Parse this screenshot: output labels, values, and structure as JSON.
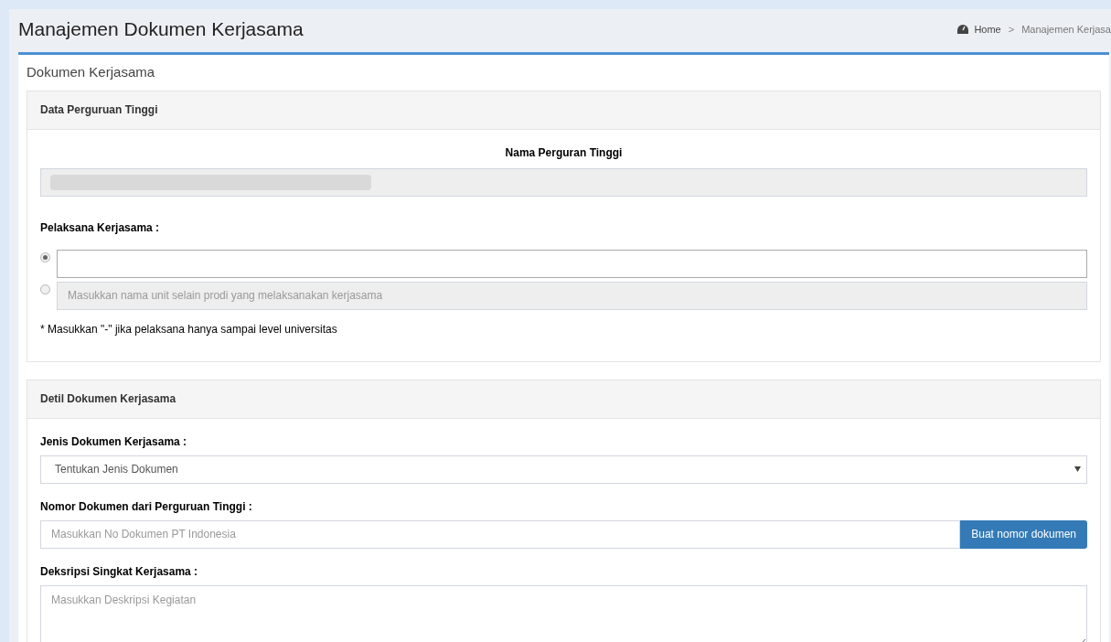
{
  "header": {
    "title": "Manajemen Dokumen Kerjasama",
    "breadcrumb": [
      {
        "label": "Home"
      },
      {
        "label": "Manajemen Kerjasa"
      }
    ],
    "breadcrumb_separator": ">"
  },
  "box_title": "Dokumen Kerjasama",
  "panels": [
    {
      "heading": "Data Perguruan Tinggi",
      "fields": [
        {
          "kind": "readonly",
          "label": "Nama Perguran Tinggi"
        },
        {
          "kind": "radio_group",
          "label": "Pelaksana Kerjasama :",
          "options": [
            {
              "selected": true,
              "disabled": false
            },
            {
              "selected": false,
              "disabled": true,
              "placeholder": "Masukkan nama unit selain prodi yang melaksanakan kerjasama"
            }
          ],
          "note": "* Masukkan \"-\" jika pelaksana hanya sampai level universitas"
        }
      ]
    },
    {
      "heading": "Detil Dokumen Kerjasama",
      "fields": [
        {
          "kind": "select",
          "label": "Jenis Dokumen Kerjasama :",
          "value": "Tentukan Jenis Dokumen"
        },
        {
          "kind": "input_button",
          "label": "Nomor Dokumen dari Perguruan Tinggi :",
          "placeholder": "Masukkan No Dokumen PT Indonesia",
          "button": "Buat nomor dokumen"
        },
        {
          "kind": "textarea",
          "label": "Deksripsi Singkat Kerjasama :",
          "placeholder": "Masukkan Deskripsi Kegiatan"
        }
      ]
    }
  ]
}
